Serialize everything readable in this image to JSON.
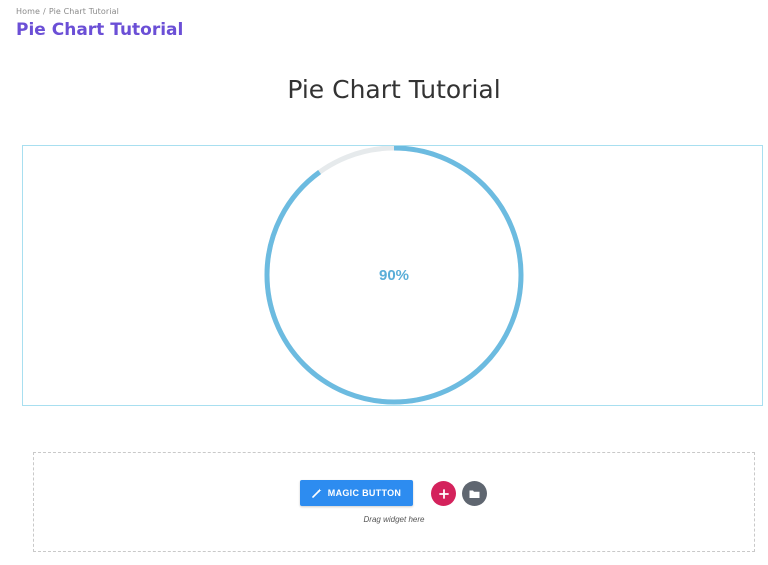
{
  "breadcrumb": {
    "home": "Home",
    "separator": "/",
    "current": "Pie Chart Tutorial"
  },
  "page_title": "Pie Chart Tutorial",
  "section_heading": "Pie Chart Tutorial",
  "widget": {
    "percent": 90,
    "label": "90%",
    "track_color": "#e6eaec",
    "fill_color": "#6cbbe0",
    "label_color": "#5aaed8"
  },
  "editor": {
    "magic_button_label": "MAGIC BUTTON",
    "magic_icon": "wand-icon",
    "add_icon": "plus-icon",
    "folder_icon": "folder-icon",
    "drag_hint": "Drag widget here"
  },
  "colors": {
    "title": "#6b4fd6",
    "magic_button": "#2d8cf0",
    "add_button": "#d4225c",
    "folder_button": "#5f6670",
    "chart_border": "#a8dff0"
  }
}
